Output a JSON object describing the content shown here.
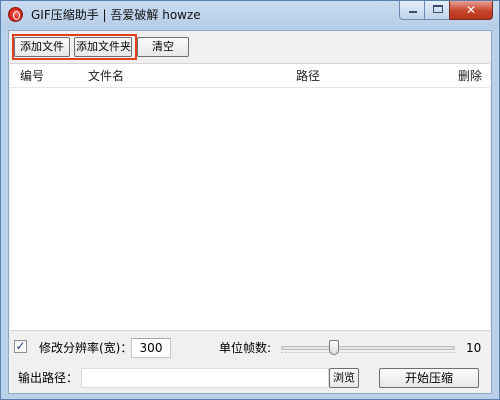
{
  "window": {
    "title": "GIF压缩助手 | 吾爱破解 howze",
    "caption": {
      "minimize": "—",
      "maximize": "□",
      "close": "✕"
    }
  },
  "toolbar": {
    "add_file": "添加文件",
    "add_folder": "添加文件夹",
    "clear": "清空"
  },
  "list": {
    "columns": [
      "编号",
      "文件名",
      "路径",
      "删除"
    ],
    "rows": []
  },
  "settings": {
    "resize_checked": true,
    "resize_label": "修改分辨率(宽)：",
    "width_value": "300",
    "fps_label": "单位帧数:",
    "fps_value": "10",
    "fps_fraction": 0.3
  },
  "output": {
    "label": "输出路径：",
    "path_value": "",
    "browse": "浏览",
    "start": "开始压缩"
  },
  "icons": {
    "app": "opera-like-red-circle-icon",
    "checkbox_mark": "checkmark-icon"
  }
}
